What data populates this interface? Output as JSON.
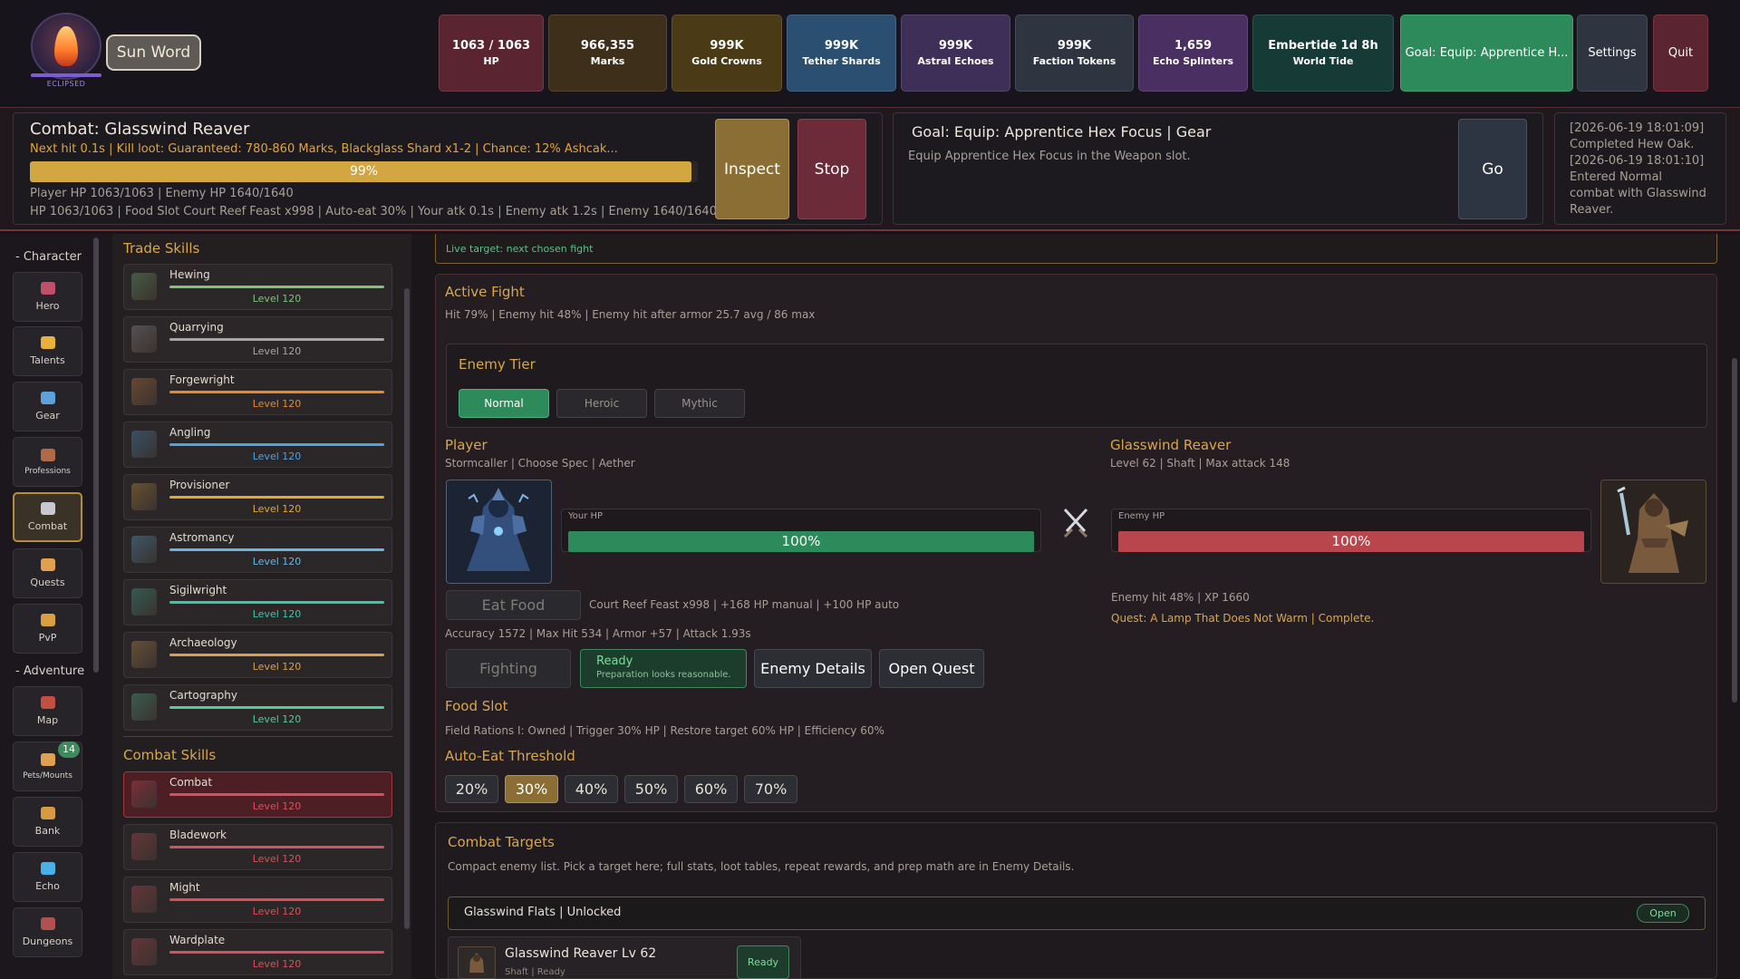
{
  "brand": {
    "badge_label": "ECLIPSED",
    "ability_label": "Sun Word"
  },
  "top_stats": [
    {
      "value": "1063 / 1063",
      "label": "HP",
      "color": "#5a2530"
    },
    {
      "value": "966,355",
      "label": "Marks",
      "color": "#3d2f1a"
    },
    {
      "value": "999K",
      "label": "Gold Crowns",
      "color": "#4a3a15"
    },
    {
      "value": "999K",
      "label": "Tether Shards",
      "color": "#2b4f70"
    },
    {
      "value": "999K",
      "label": "Astral Echoes",
      "color": "#3d2f57"
    },
    {
      "value": "999K",
      "label": "Faction Tokens",
      "color": "#2e3540"
    },
    {
      "value": "1,659",
      "label": "Echo Splinters",
      "color": "#4a2f63"
    },
    {
      "value": "Embertide 1d 8h",
      "label": "World Tide",
      "color": "#163b36"
    }
  ],
  "top_buttons": {
    "goal": "Goal: Equip: Apprentice H...",
    "settings": "Settings",
    "quit": "Quit"
  },
  "combat": {
    "title": "Combat: Glasswind Reaver",
    "next_line": "Next hit 0.1s | Kill loot: Guaranteed: 780-860 Marks, Blackglass Shard x1-2 | Chance: 12% Ashcak...",
    "progress_pct": 99,
    "progress_label": "99%",
    "line1": "Player HP 1063/1063 | Enemy HP 1640/1640",
    "line2": "HP 1063/1063 | Food Slot Court Reef Feast x998 | Auto-eat 30% | Your atk 0.1s | Enemy atk 1.2s | Enemy 1640/1640",
    "inspect_label": "Inspect",
    "stop_label": "Stop"
  },
  "goal": {
    "title": "Goal: Equip: Apprentice Hex Focus | Gear",
    "desc": "Equip Apprentice Hex Focus in the Weapon slot.",
    "go_label": "Go"
  },
  "log": {
    "lines": [
      "[2026-06-19 18:01:09]",
      "Completed Hew Oak.",
      "[2026-06-19 18:01:10]",
      "Entered Normal",
      "combat with Glasswind",
      "Reaver."
    ]
  },
  "nav": {
    "character_header": "- Character",
    "adventure_header": "- Adventure",
    "items": [
      {
        "label": "Hero",
        "icon": "hero-icon",
        "color": "#c0506a"
      },
      {
        "label": "Talents",
        "icon": "star-icon",
        "color": "#e8b23a"
      },
      {
        "label": "Gear",
        "icon": "gear-icon",
        "color": "#5ea0d8"
      },
      {
        "label": "Professions",
        "icon": "professions-icon",
        "color": "#b06a4a"
      },
      {
        "label": "Combat",
        "icon": "crossed-swords-icon",
        "color": "#c8c8d0"
      },
      {
        "label": "Quests",
        "icon": "scroll-icon",
        "color": "#e0a050"
      },
      {
        "label": "PvP",
        "icon": "pvp-icon",
        "color": "#d8a040"
      },
      {
        "label": "Map",
        "icon": "map-icon",
        "color": "#c05040"
      },
      {
        "label": "Pets/Mounts",
        "icon": "paw-icon",
        "color": "#e0a050"
      },
      {
        "label": "Bank",
        "icon": "chest-icon",
        "color": "#d89a40"
      },
      {
        "label": "Echo",
        "icon": "crystal-icon",
        "color": "#4ab0e8"
      },
      {
        "label": "Dungeons",
        "icon": "dungeon-icon",
        "color": "#b05050"
      }
    ],
    "pets_badge": "14"
  },
  "skills": {
    "trade_header": "Trade Skills",
    "combat_header": "Combat Skills",
    "trade": [
      {
        "name": "Hewing",
        "level": "Level 120",
        "color": "#7dc47a",
        "icon": "axe-icon"
      },
      {
        "name": "Quarrying",
        "level": "Level 120",
        "color": "#a6a6a6",
        "icon": "pickaxe-icon"
      },
      {
        "name": "Forgewright",
        "level": "Level 120",
        "color": "#e08a3a",
        "icon": "anvil-icon"
      },
      {
        "name": "Angling",
        "level": "Level 120",
        "color": "#4ea3e0",
        "icon": "fishing-icon"
      },
      {
        "name": "Provisioner",
        "level": "Level 120",
        "color": "#e0a83a",
        "icon": "cooking-icon"
      },
      {
        "name": "Astromancy",
        "level": "Level 120",
        "color": "#5fb8e8",
        "icon": "astrolabe-icon"
      },
      {
        "name": "Sigilwright",
        "level": "Level 120",
        "color": "#3fc4a6",
        "icon": "quill-icon"
      },
      {
        "name": "Archaeology",
        "level": "Level 120",
        "color": "#d8a050",
        "icon": "relic-icon"
      },
      {
        "name": "Cartography",
        "level": "Level 120",
        "color": "#58c89a",
        "icon": "map-scroll-icon"
      }
    ],
    "combat": [
      {
        "name": "Combat",
        "level": "Level 120",
        "color": "#d8505a",
        "icon": "crossed-swords-icon"
      },
      {
        "name": "Bladework",
        "level": "Level 120",
        "color": "#d8505a",
        "icon": "sword-icon"
      },
      {
        "name": "Might",
        "level": "Level 120",
        "color": "#d8505a",
        "icon": "burst-icon"
      },
      {
        "name": "Wardplate",
        "level": "Level 120",
        "color": "#d8505a",
        "icon": "shield-icon"
      }
    ]
  },
  "main": {
    "live_target": "Live target: next chosen fight",
    "active_fight_title": "Active Fight",
    "active_fight_line": "Hit 79% | Enemy hit 48% | Enemy hit after armor 25.7 avg / 86 max",
    "tier_title": "Enemy Tier",
    "tiers": [
      "Normal",
      "Heroic",
      "Mythic"
    ],
    "player": {
      "title": "Player",
      "sub": "Stormcaller | Choose Spec | Aether",
      "hp_label": "Your HP",
      "hp_pct": 100,
      "hp_text": "100%"
    },
    "enemy": {
      "title": "Glasswind Reaver",
      "sub": "Level 62 | Shaft | Max attack 148",
      "hp_label": "Enemy HP",
      "hp_pct": 100,
      "hp_text": "100%",
      "hit_line": "Enemy hit 48% | XP 1660",
      "quest_line": "Quest: A Lamp That Does Not Warm | Complete."
    },
    "eat_food": "Eat Food",
    "food_line": "Court Reef Feast x998 | +168 HP manual | +100 HP auto",
    "acc_line": "Accuracy 1572 | Max Hit 534 | Armor +57 | Attack 1.93s",
    "fighting_label": "Fighting",
    "ready_title": "Ready",
    "ready_sub": "Preparation looks reasonable.",
    "enemy_details": "Enemy Details",
    "open_quest": "Open Quest",
    "food_slot_title": "Food Slot",
    "food_slot_line": "Field Rations I: Owned | Trigger 30% HP | Restore target 60% HP | Efficiency 60%",
    "auto_eat_title": "Auto-Eat Threshold",
    "thresholds": [
      "20%",
      "30%",
      "40%",
      "50%",
      "60%",
      "70%"
    ],
    "selected_threshold": "30%"
  },
  "targets": {
    "title": "Combat Targets",
    "desc": "Compact enemy list. Pick a target here; full stats, loot tables, repeat rewards, and prep math are in Enemy Details.",
    "zone": "Glasswind Flats | Unlocked",
    "zone_badge": "Open",
    "card_name": "Glasswind Reaver  Lv 62",
    "card_sub": "Shaft | Ready",
    "card_status": "Ready"
  }
}
